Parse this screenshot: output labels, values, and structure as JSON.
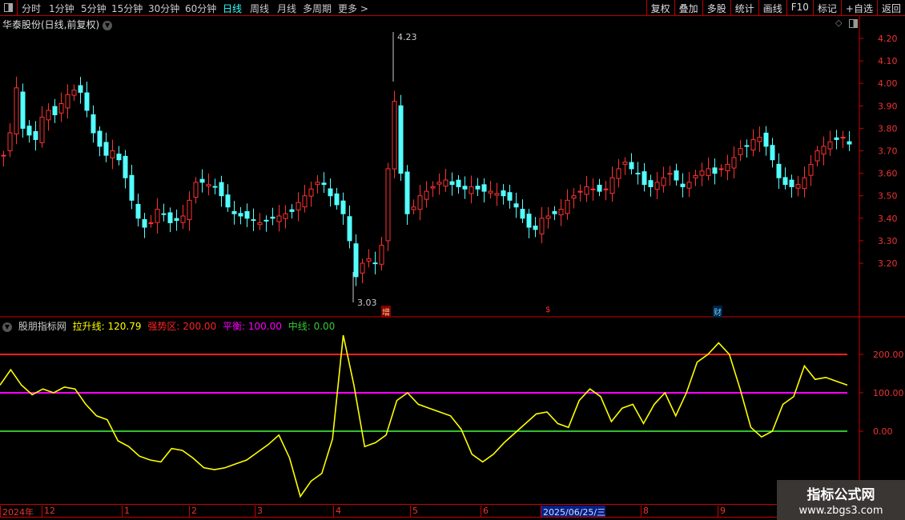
{
  "toolbar": {
    "periods": [
      "分时",
      "1分钟",
      "5分钟",
      "15分钟",
      "30分钟",
      "60分钟",
      "日线",
      "周线",
      "月线",
      "多周期",
      "更多 >"
    ],
    "active_period": "日线",
    "buttons": [
      "复权",
      "叠加",
      "多股",
      "统计",
      "画线",
      "F10",
      "标记",
      "+自选",
      "返回"
    ]
  },
  "header": {
    "title": "华泰股份(日线,前复权)"
  },
  "price_axis": {
    "ticks": [
      "4.20",
      "4.10",
      "4.00",
      "3.90",
      "3.80",
      "3.70",
      "3.60",
      "3.50",
      "3.40",
      "3.30",
      "3.20"
    ],
    "high_label": "4.23",
    "low_label": "3.03"
  },
  "markers": {
    "m1": "增",
    "m2": "$",
    "m3": "财"
  },
  "indicator": {
    "name": "股朋指标网",
    "items": [
      {
        "label": "拉升线: 120.79",
        "color": "#ffff00"
      },
      {
        "label": "强势区: 200.00",
        "color": "#ff2020"
      },
      {
        "label": "平衡: 100.00",
        "color": "#ff00ff"
      },
      {
        "label": "中线: 0.00",
        "color": "#30c030"
      }
    ],
    "ticks": [
      "200.00",
      "100.00",
      "0.00"
    ]
  },
  "datebar": {
    "labels": [
      "2024年",
      "12",
      "1",
      "2",
      "3",
      "4",
      "5",
      "6",
      "2025/06/25/三",
      "8",
      "9"
    ]
  },
  "watermark": {
    "line1": "指标公式网",
    "line2": "www.zbgs3.com"
  },
  "chart_data": {
    "type": "candlestick+line",
    "price_range": [
      3.0,
      4.25
    ],
    "closes": [
      3.68,
      3.78,
      3.98,
      3.8,
      3.77,
      3.75,
      3.85,
      3.88,
      3.86,
      3.91,
      3.95,
      3.97,
      3.96,
      3.88,
      3.78,
      3.72,
      3.68,
      3.7,
      3.66,
      3.58,
      3.48,
      3.4,
      3.36,
      3.38,
      3.44,
      3.42,
      3.38,
      3.39,
      3.41,
      3.48,
      3.56,
      3.56,
      3.55,
      3.54,
      3.5,
      3.45,
      3.42,
      3.41,
      3.4,
      3.39,
      3.38,
      3.39,
      3.4,
      3.41,
      3.42,
      3.43,
      3.47,
      3.5,
      3.53,
      3.56,
      3.55,
      3.5,
      3.46,
      3.42,
      3.3,
      3.14,
      3.2,
      3.22,
      3.2,
      3.28,
      3.62,
      3.92,
      3.6,
      3.42,
      3.45,
      3.5,
      3.52,
      3.54,
      3.56,
      3.57,
      3.55,
      3.54,
      3.53,
      3.54,
      3.53,
      3.52,
      3.52,
      3.51,
      3.5,
      3.48,
      3.45,
      3.4,
      3.36,
      3.35,
      3.4,
      3.41,
      3.42,
      3.44,
      3.48,
      3.5,
      3.52,
      3.54,
      3.53,
      3.52,
      3.53,
      3.58,
      3.62,
      3.65,
      3.62,
      3.6,
      3.55,
      3.54,
      3.56,
      3.58,
      3.6,
      3.57,
      3.54,
      3.56,
      3.59,
      3.61,
      3.62,
      3.6,
      3.62,
      3.64,
      3.67,
      3.71,
      3.72,
      3.75,
      3.76,
      3.72,
      3.66,
      3.58,
      3.55,
      3.54,
      3.55,
      3.58,
      3.64,
      3.7,
      3.72,
      3.74,
      3.75,
      3.76,
      3.73
    ],
    "indicator_range": [
      -180,
      290
    ],
    "indicator_values": [
      120,
      160,
      120,
      95,
      110,
      100,
      115,
      110,
      70,
      40,
      30,
      -25,
      -40,
      -65,
      -75,
      -80,
      -45,
      -50,
      -70,
      -95,
      -100,
      -95,
      -85,
      -75,
      -55,
      -35,
      -10,
      -70,
      -170,
      -130,
      -110,
      -20,
      250,
      120,
      -40,
      -30,
      -10,
      80,
      100,
      70,
      60,
      50,
      40,
      5,
      -60,
      -80,
      -60,
      -30,
      -5,
      20,
      45,
      50,
      20,
      10,
      80,
      110,
      90,
      25,
      60,
      70,
      20,
      70,
      100,
      40,
      100,
      180,
      200,
      230,
      200,
      110,
      10,
      -15,
      0,
      70,
      90,
      170,
      135,
      140,
      130,
      120
    ],
    "reference_lines": [
      200,
      100,
      0
    ]
  }
}
